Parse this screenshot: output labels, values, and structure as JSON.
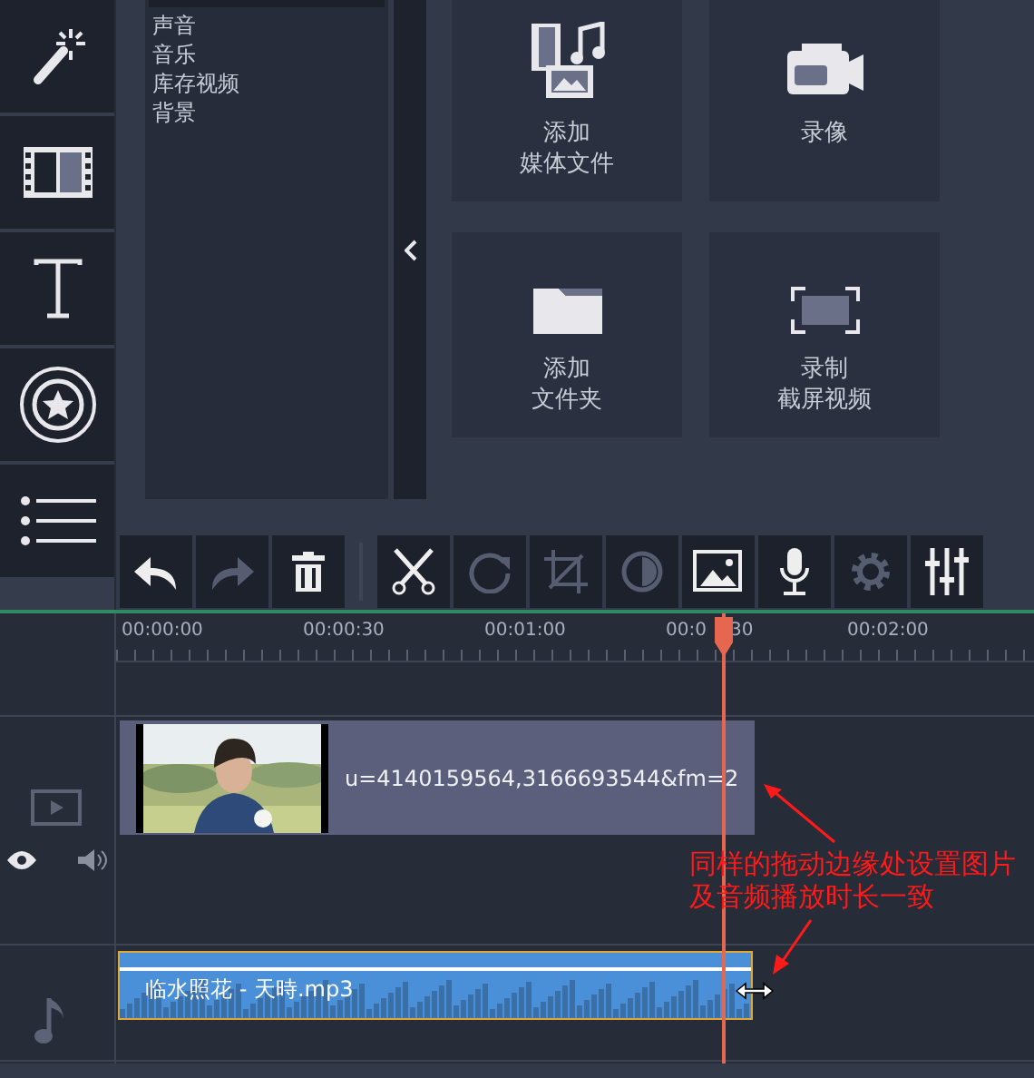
{
  "sidebar": {
    "items": [
      {
        "kind": "magic"
      },
      {
        "kind": "film"
      },
      {
        "kind": "text"
      },
      {
        "kind": "sticker"
      },
      {
        "kind": "list"
      }
    ]
  },
  "media_panel": {
    "categories": [
      {
        "label": "声音"
      },
      {
        "label": "音乐"
      },
      {
        "label": "库存视频"
      },
      {
        "label": "背景"
      }
    ]
  },
  "tiles": [
    {
      "kind": "media",
      "lines": [
        "添加",
        "媒体文件"
      ]
    },
    {
      "kind": "camera",
      "lines": [
        "录像"
      ]
    },
    {
      "kind": "folder",
      "lines": [
        "添加",
        "文件夹"
      ]
    },
    {
      "kind": "screen",
      "lines": [
        "录制",
        "截屏视频"
      ]
    }
  ],
  "toolbar": [
    {
      "kind": "undo",
      "disabled": false
    },
    {
      "kind": "redo",
      "disabled": true
    },
    {
      "kind": "delete",
      "disabled": false
    },
    {
      "kind": "separator"
    },
    {
      "kind": "cut",
      "disabled": false
    },
    {
      "kind": "rotate",
      "disabled": true
    },
    {
      "kind": "crop",
      "disabled": true
    },
    {
      "kind": "color",
      "disabled": true
    },
    {
      "kind": "picture",
      "disabled": false
    },
    {
      "kind": "mic",
      "disabled": false
    },
    {
      "kind": "gear",
      "disabled": true
    },
    {
      "kind": "mixer",
      "disabled": false
    }
  ],
  "timeline": {
    "ruler": [
      {
        "parts": [
          "00:00:00"
        ]
      },
      {
        "parts": [
          "00:00:30"
        ]
      },
      {
        "parts": [
          "00:01:00"
        ]
      },
      {
        "parts": [
          "00:0",
          "30"
        ]
      },
      {
        "parts": [
          "00:02:00"
        ]
      }
    ],
    "video_clip": {
      "title": "u=4140159564,3166693544&fm=2"
    },
    "audio_clip": {
      "title": "临水照花 - 天時.mp3"
    },
    "annotation": {
      "lines": [
        "同样的拖动边缘处设置图片",
        "及音频播放时长一致"
      ]
    }
  }
}
